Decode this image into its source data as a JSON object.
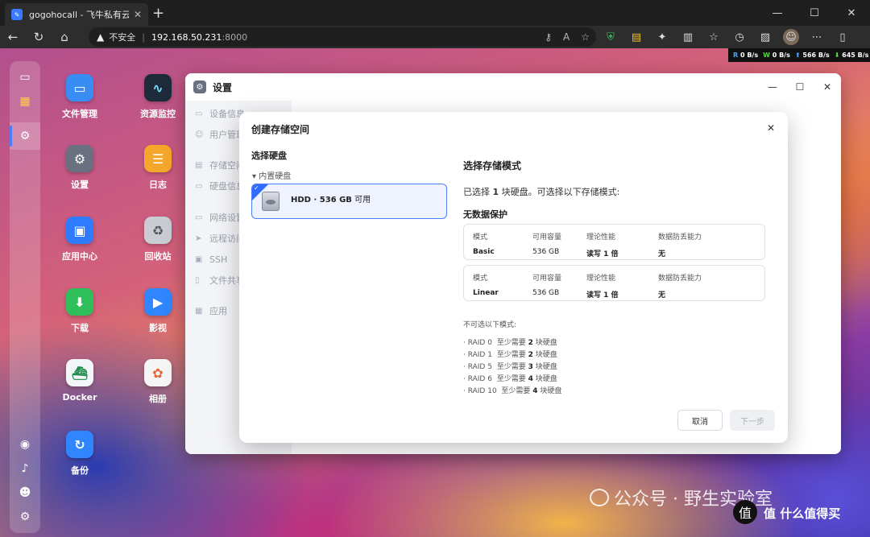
{
  "browser": {
    "tab_title": "gogohocall - 飞牛私有云fnOS",
    "tab_close": "✕",
    "new_tab": "+",
    "favicon": "✎",
    "win_min": "—",
    "win_max": "☐",
    "win_close": "✕",
    "insecure_label": "不安全",
    "url_host": "192.168.50.231",
    "url_port": ":8000"
  },
  "netspeed": {
    "r_label": "R",
    "r_value": "0 B/s",
    "w_label": "W",
    "w_value": "0 B/s",
    "up_value": "566 B/s",
    "down_value": "645 B/s"
  },
  "desktop_apps": [
    {
      "label": "文件管理",
      "color": "#3a8cf5",
      "glyph": "▭"
    },
    {
      "label": "资源监控",
      "color": "#1d2b3a",
      "glyph": "∿"
    },
    {
      "label": "设置",
      "color": "#6b7080",
      "glyph": "⚙"
    },
    {
      "label": "日志",
      "color": "#f4a72a",
      "glyph": "☰"
    },
    {
      "label": "应用中心",
      "color": "#2f7bff",
      "glyph": "▣"
    },
    {
      "label": "回收站",
      "color": "#c9ccd3",
      "glyph": "♻"
    },
    {
      "label": "下载",
      "color": "#2fbf5a",
      "glyph": "⬇"
    },
    {
      "label": "影视",
      "color": "#2f86ff",
      "glyph": "▶"
    },
    {
      "label": "Docker",
      "color": "#f3f6f8",
      "glyph": "⛴"
    },
    {
      "label": "相册",
      "color": "#f5f5f5",
      "glyph": "✿"
    },
    {
      "label": "备份",
      "color": "#2f86ff",
      "glyph": "↻"
    }
  ],
  "settings_window": {
    "title": "设置",
    "min": "—",
    "max": "☐",
    "close": "✕",
    "sidebar": [
      {
        "label": "设备信息"
      },
      {
        "label": "用户管理"
      },
      {
        "label": "存储空间"
      },
      {
        "label": "硬盘信息"
      },
      {
        "label": "网络设置"
      },
      {
        "label": "远程访问"
      },
      {
        "label": "SSH"
      },
      {
        "label": "文件共享"
      },
      {
        "label": "应用"
      }
    ]
  },
  "dialog": {
    "title": "创建存储空间",
    "close": "✕",
    "select_disk_title": "选择硬盘",
    "internal_disk_label": "▾ 内置硬盘",
    "disk": {
      "name": "HDD · 536 GB",
      "status": "可用"
    },
    "mode_title": "选择存储模式",
    "desc_pre": "已选择 ",
    "desc_count": "1",
    "desc_post": " 块硬盘。可选择以下存储模式:",
    "no_protection_title": "无数据保护",
    "mode_headers": [
      "模式",
      "可用容量",
      "理论性能",
      "数据防丢能力"
    ],
    "modes": [
      {
        "mode": "Basic",
        "capacity": "536 GB",
        "performance": "读写 1 倍",
        "protection": "无"
      },
      {
        "mode": "Linear",
        "capacity": "536 GB",
        "performance": "读写 1 倍",
        "protection": "无"
      }
    ],
    "unavailable_title": "不可选以下模式:",
    "unavailable": [
      {
        "name": "· RAID 0",
        "pre": "至少需要 ",
        "count": "2",
        "post": " 块硬盘"
      },
      {
        "name": "· RAID 1",
        "pre": "至少需要 ",
        "count": "2",
        "post": " 块硬盘"
      },
      {
        "name": "· RAID 5",
        "pre": "至少需要 ",
        "count": "3",
        "post": " 块硬盘"
      },
      {
        "name": "· RAID 6",
        "pre": "至少需要 ",
        "count": "4",
        "post": " 块硬盘"
      },
      {
        "name": "· RAID 10",
        "pre": "至少需要 ",
        "count": "4",
        "post": " 块硬盘"
      }
    ],
    "cancel_label": "取消",
    "next_label": "下一步"
  },
  "watermark": {
    "text": "公众号 · 野生实验室",
    "site": "值 什么值得买",
    "site_glyph": "值"
  }
}
